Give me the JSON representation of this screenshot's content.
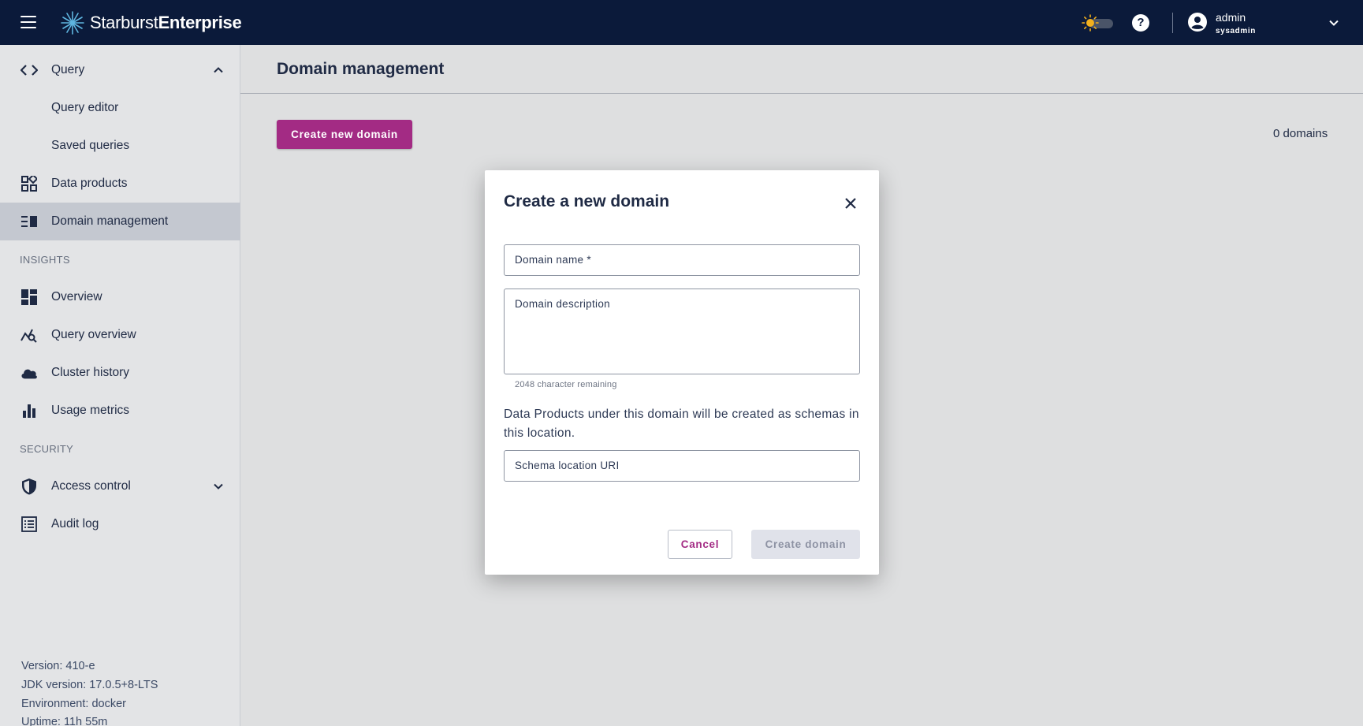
{
  "topbar": {
    "logo_brand": "Starburst",
    "logo_product": "Enterprise",
    "help_label": "?",
    "user": {
      "name": "admin",
      "role": "sysadmin"
    }
  },
  "sidebar": {
    "items": [
      {
        "label": "Query",
        "icon": "code-brackets-icon",
        "expanded": true
      },
      {
        "label": "Query editor"
      },
      {
        "label": "Saved queries"
      },
      {
        "label": "Data products",
        "icon": "data-products-icon"
      },
      {
        "label": "Domain management",
        "icon": "domain-management-icon",
        "active": true
      },
      {
        "label": "Overview",
        "icon": "dashboard-icon"
      },
      {
        "label": "Query overview",
        "icon": "query-insights-icon"
      },
      {
        "label": "Cluster history",
        "icon": "cloud-icon"
      },
      {
        "label": "Usage metrics",
        "icon": "bar-chart-icon"
      },
      {
        "label": "Access control",
        "icon": "shield-icon",
        "expanded": false
      },
      {
        "label": "Audit log",
        "icon": "list-icon"
      }
    ],
    "sections": {
      "insights": "INSIGHTS",
      "security": "SECURITY"
    },
    "version": {
      "version": "Version: 410-e",
      "jdk": "JDK version: 17.0.5+8-LTS",
      "environment": "Environment: docker",
      "uptime": "Uptime: 11h 55m"
    }
  },
  "main": {
    "title": "Domain management",
    "create_button": "Create new domain",
    "domain_count": "0 domains"
  },
  "modal": {
    "title": "Create a new domain",
    "domain_name_placeholder": "Domain name *",
    "domain_description_placeholder": "Domain description",
    "char_remaining": "2048 character remaining",
    "schema_note": "Data Products under this domain will be created as schemas in this location.",
    "schema_uri_placeholder": "Schema location URI",
    "cancel_label": "Cancel",
    "create_label": "Create domain"
  },
  "colors": {
    "topbar_bg": "#0b1a3a",
    "accent": "#a32b84",
    "active_nav_bg": "#c4c8d0"
  }
}
